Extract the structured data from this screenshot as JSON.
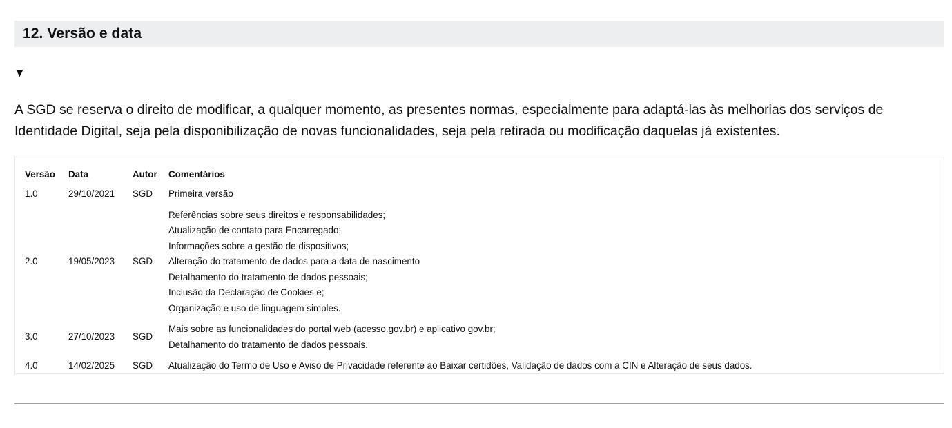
{
  "section": {
    "title": "12. Versão e data",
    "toggle_icon": "▼"
  },
  "paragraph": "A SGD se reserva o direito de modificar, a qualquer momento, as presentes normas, especialmente para adaptá-las às melhorias dos serviços de Identidade Digital, seja pela disponibilização de novas funcionalidades, seja pela retirada ou modificação daquelas já existentes.",
  "table": {
    "headers": [
      "Versão",
      "Data",
      "Autor",
      "Comentários"
    ],
    "rows": [
      {
        "version": "1.0",
        "date": "29/10/2021",
        "author": "SGD",
        "comments": [
          "Primeira versão"
        ]
      },
      {
        "version": "2.0",
        "date": "19/05/2023",
        "author": "SGD",
        "comments": [
          "Referências sobre seus direitos e responsabilidades;",
          "Atualização de contato para Encarregado;",
          "Informações sobre a gestão de dispositivos;",
          "Alteração do tratamento de dados para a data de nascimento",
          "Detalhamento do tratamento de dados pessoais;",
          "Inclusão da Declaração de Cookies e;",
          "Organização e uso de linguagem simples."
        ]
      },
      {
        "version": "3.0",
        "date": "27/10/2023",
        "author": "SGD",
        "comments": [
          "Mais sobre as funcionalidades do portal web (acesso.gov.br) e aplicativo gov.br;",
          "Detalhamento do tratamento de dados pessoais."
        ]
      },
      {
        "version": "4.0",
        "date": "14/02/2025",
        "author": "SGD",
        "comments": [
          "Atualização do Termo de Uso e Aviso de Privacidade referente ao Baixar certidões, Validação de dados com a CIN e Alteração de seus dados."
        ]
      }
    ]
  }
}
